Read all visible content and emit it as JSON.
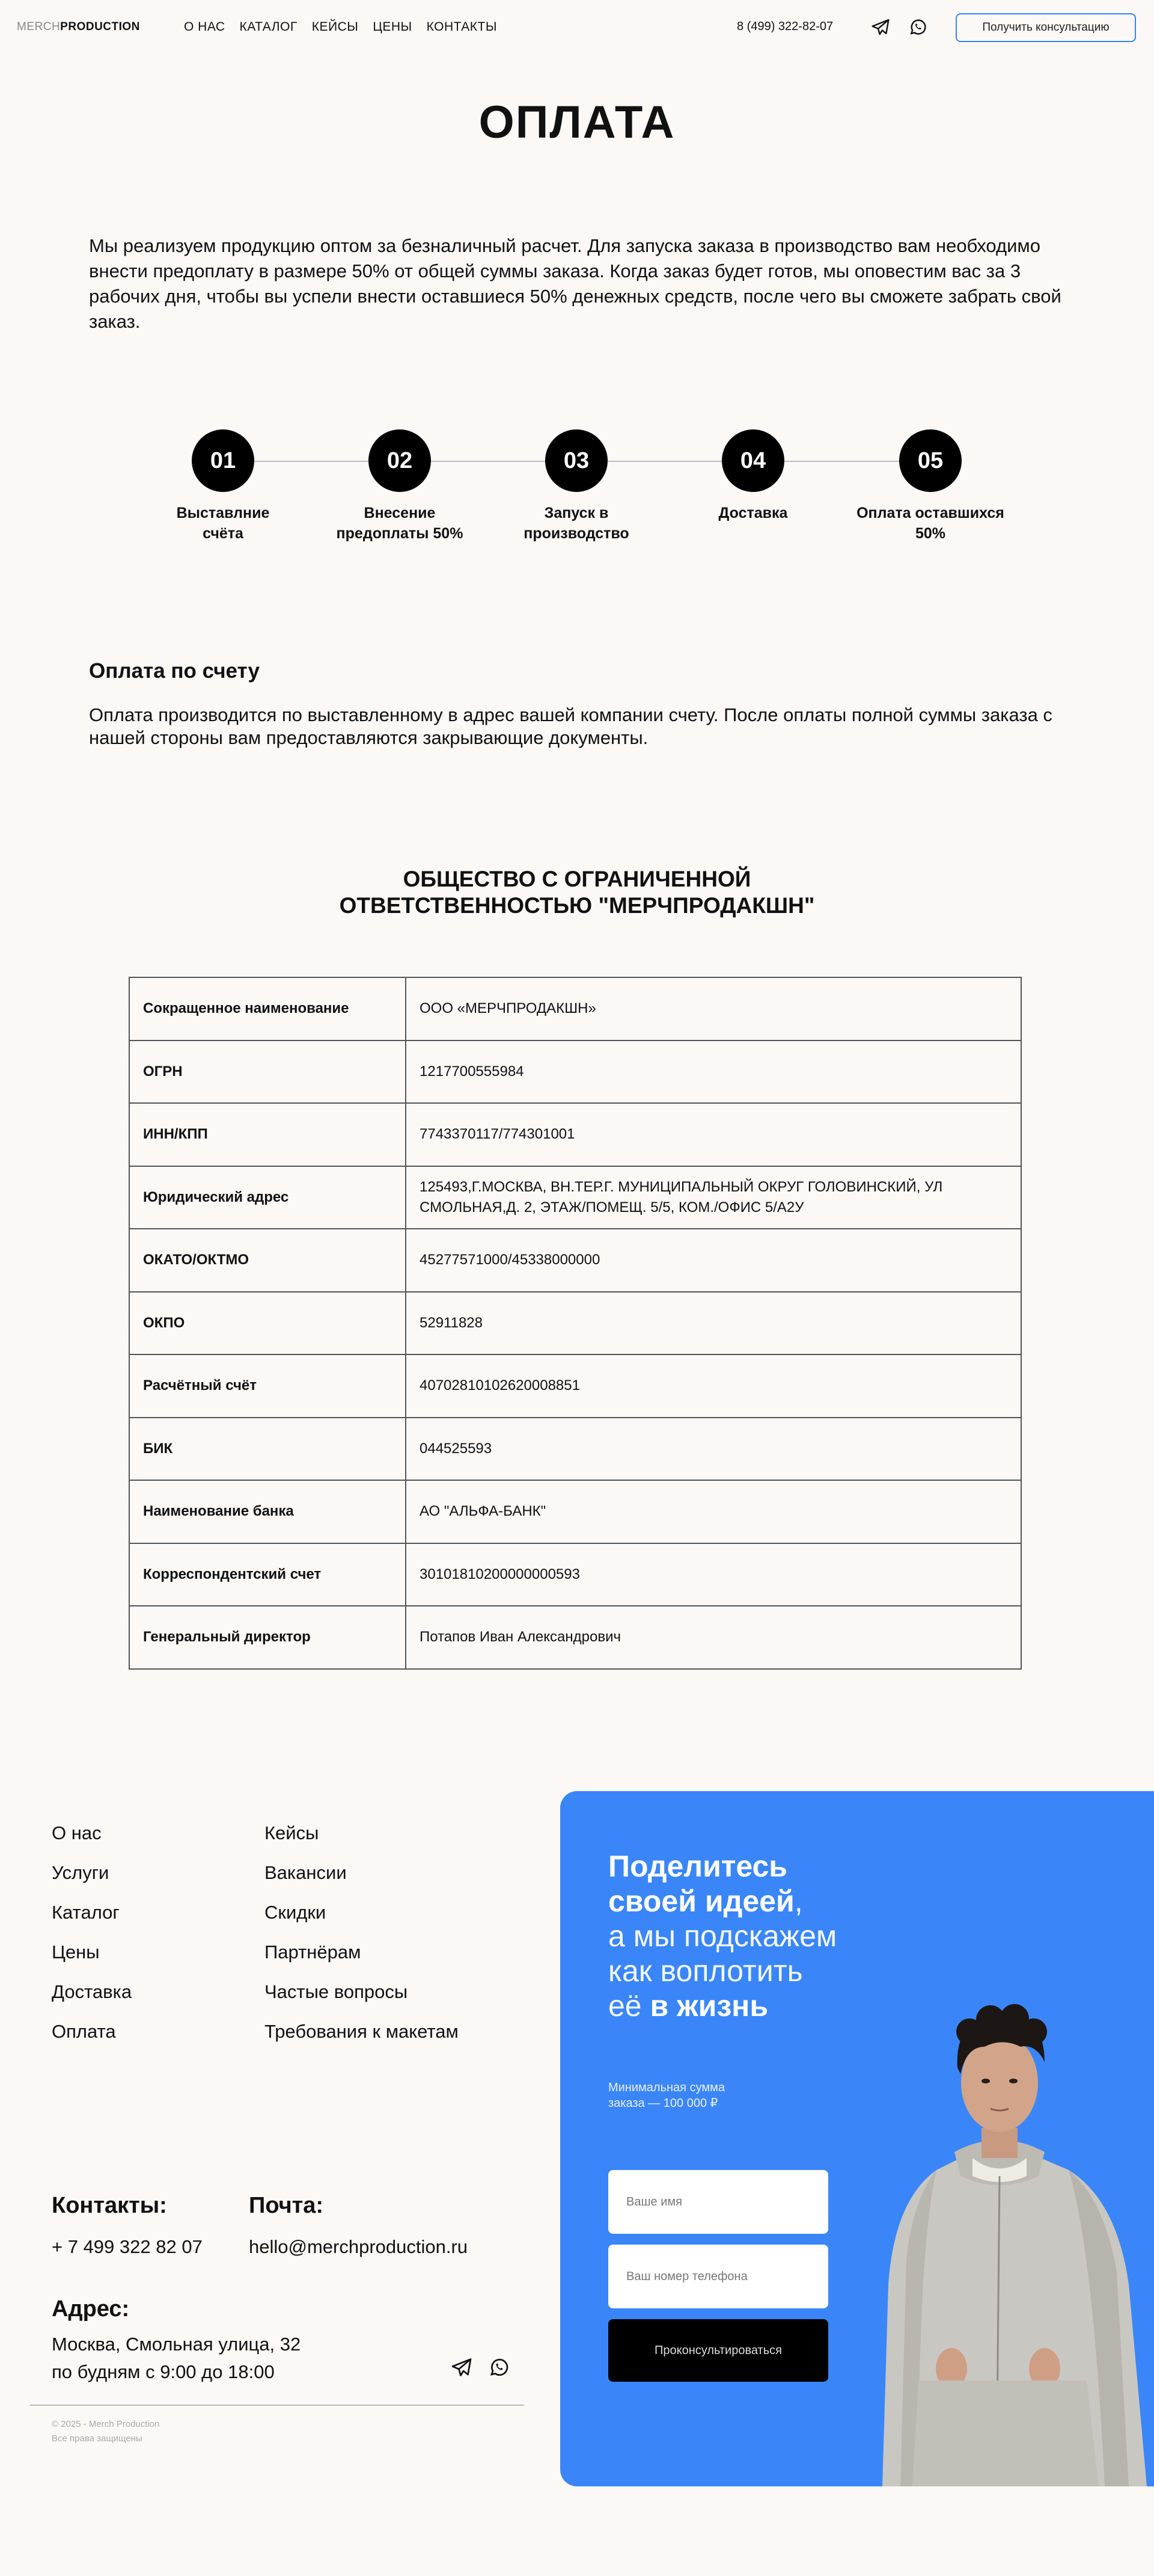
{
  "header": {
    "logo_part1": "MERCH",
    "logo_part2": "PRODUCTION",
    "nav": [
      "О НАС",
      "КАТАЛОГ",
      "КЕЙСЫ",
      "ЦЕНЫ",
      "КОНТАКТЫ"
    ],
    "phone": "8 (499) 322-82-07",
    "consult_button": "Получить консультацию"
  },
  "page_title": "ОПЛАТА",
  "intro": "Мы реализуем продукцию оптом за безналичный расчет. Для запуска заказа в производство вам необходимо внести предоплату в размере 50% от общей суммы заказа. Когда заказ будет готов, мы оповестим вас за 3 рабочих дня, чтобы вы успели внести оставшиеся 50% денежных средств, после чего вы сможете забрать свой заказ.",
  "steps": [
    {
      "num": "01",
      "label": "Выставлние счёта"
    },
    {
      "num": "02",
      "label": "Внесение предоплаты 50%"
    },
    {
      "num": "03",
      "label": "Запуск в производство"
    },
    {
      "num": "04",
      "label": "Доставка"
    },
    {
      "num": "05",
      "label": "Оплата оставшихся 50%"
    }
  ],
  "invoice": {
    "heading": "Оплата по счету",
    "text": "Оплата производится по выставленному в адрес вашей компании счету. После оплаты полной суммы заказа с нашей стороны вам предоставляются закрывающие документы."
  },
  "company": {
    "line1": "ОБЩЕСТВО С ОГРАНИЧЕННОЙ",
    "line2": "ОТВЕТСТВЕННОСТЬЮ \"МЕРЧПРОДАКШН\""
  },
  "requisites": [
    {
      "key": "Сокращенное наименование",
      "value": "ООО «МЕРЧПРОДАКШН»"
    },
    {
      "key": "ОГРН",
      "value": "1217700555984"
    },
    {
      "key": "ИНН/КПП",
      "value": "7743370117/774301001"
    },
    {
      "key": "Юридический адрес",
      "value": "125493,Г.МОСКВА, ВН.ТЕР.Г. МУНИЦИПАЛЬНЫЙ ОКРУГ ГОЛОВИНСКИЙ, УЛ СМОЛЬНАЯ,Д. 2, ЭТАЖ/ПОМЕЩ. 5/5, КОМ./ОФИС 5/А2У"
    },
    {
      "key": "ОКАТО/ОКТМО",
      "value": "45277571000/45338000000"
    },
    {
      "key": "ОКПО",
      "value": "52911828"
    },
    {
      "key": "Расчётный счёт",
      "value": "40702810102620008851"
    },
    {
      "key": "БИК",
      "value": "044525593"
    },
    {
      "key": "Наименование банка",
      "value": "АО \"АЛЬФА-БАНК\""
    },
    {
      "key": "Корреспондентский счет",
      "value": "30101810200000000593"
    },
    {
      "key": "Генеральный директор",
      "value": "Потапов Иван Александрович"
    }
  ],
  "footer": {
    "nav_col1": [
      "О нас",
      "Услуги",
      "Каталог",
      "Цены",
      "Доставка",
      "Оплата"
    ],
    "nav_col2": [
      "Кейсы",
      "Вакансии",
      "Скидки",
      "Партнёрам",
      "Частые вопросы",
      "Требования к макетам"
    ],
    "contacts_heading": "Контакты:",
    "contacts_phone": "+ 7 499 322 82 07",
    "mail_heading": "Почта:",
    "mail": "hello@merchproduction.ru",
    "address_heading": "Адрес:",
    "address": "Москва, Смольная улица, 32",
    "hours": "по будням с 9:00 до 18:00",
    "copyright": "© 2025 - Merch Production",
    "rights": "Все права защищены"
  },
  "form": {
    "head_b1": "Поделитесь",
    "head_b2": "своей идеей",
    "head_comma": ",",
    "head_n1": "а мы подскажем",
    "head_n2": "как воплотить",
    "head_n3": "её ",
    "head_b3": "в жизнь",
    "min_line1": "Минимальная сумма",
    "min_line2": "заказа — 100 000 ₽",
    "name_placeholder": "Ваше имя",
    "phone_placeholder": "Ваш номер телефона",
    "submit": "Проконсультироваться"
  },
  "colors": {
    "accent": "#3a86f8",
    "background": "#fbf8f6",
    "text": "#111111"
  }
}
